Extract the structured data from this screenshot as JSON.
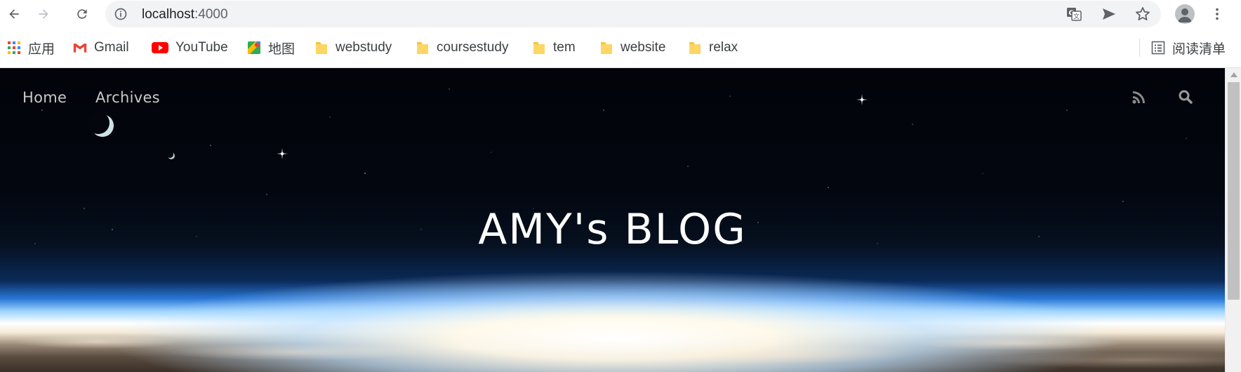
{
  "toolbar": {
    "url_host": "localhost",
    "url_port": ":4000"
  },
  "bookmarks": {
    "items": [
      {
        "label": "应用",
        "icon": "apps-grid-icon"
      },
      {
        "label": "Gmail",
        "icon": "gmail-icon"
      },
      {
        "label": "YouTube",
        "icon": "youtube-icon"
      },
      {
        "label": "地图",
        "icon": "maps-icon"
      },
      {
        "label": "webstudy",
        "icon": "folder-icon"
      },
      {
        "label": "coursestudy",
        "icon": "folder-icon"
      },
      {
        "label": "tem",
        "icon": "folder-icon"
      },
      {
        "label": "website",
        "icon": "folder-icon"
      },
      {
        "label": "relax",
        "icon": "folder-icon"
      }
    ],
    "reading_list": "阅读清单"
  },
  "site": {
    "nav": [
      {
        "label": "Home"
      },
      {
        "label": "Archives"
      }
    ],
    "title": "AMY's BLOG"
  },
  "colors": {
    "folder": "#fdd663",
    "youtube": "#ff0000",
    "gmail": "#ea4335"
  }
}
